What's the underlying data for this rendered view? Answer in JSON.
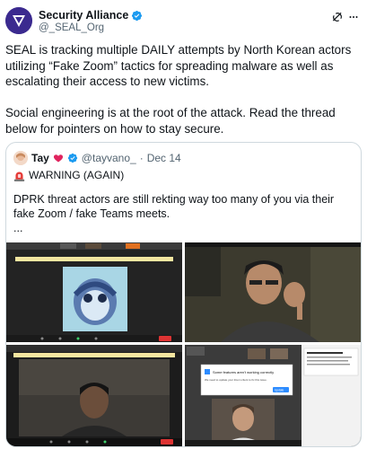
{
  "tweet": {
    "author_name": "Security Alliance",
    "author_handle": "@_SEAL_Org",
    "paragraphs": [
      "SEAL is tracking multiple DAILY attempts by North Korean actors utilizing “Fake Zoom” tactics for spreading malware as well as escalating their access to new victims.",
      "Social engineering is at the root of the attack. Read the thread below for pointers on how to stay secure."
    ]
  },
  "quote": {
    "author_name": "Tay",
    "author_handle": "@tayvano_",
    "separator": "·",
    "date": "Dec 14",
    "warning": "WARNING (AGAIN)",
    "text": "DPRK threat actors are still rekting way too many of you via their fake Zoom / fake Teams meets.",
    "ellipsis": "..."
  },
  "media": {
    "dialog_title": "Some features aren't working correctly",
    "dialog_body": "We need to update your Zoom client to fix this issue.",
    "dialog_button": "Update"
  },
  "colors": {
    "verified": "#1d9bf0",
    "seal_logo": "#3b2a8f",
    "text_primary": "#0f1419",
    "text_secondary": "#536471",
    "border": "#cfd9de"
  },
  "icons": [
    "verified-badge-icon",
    "grok-icon",
    "more-icon",
    "heart-icon",
    "siren-icon"
  ]
}
